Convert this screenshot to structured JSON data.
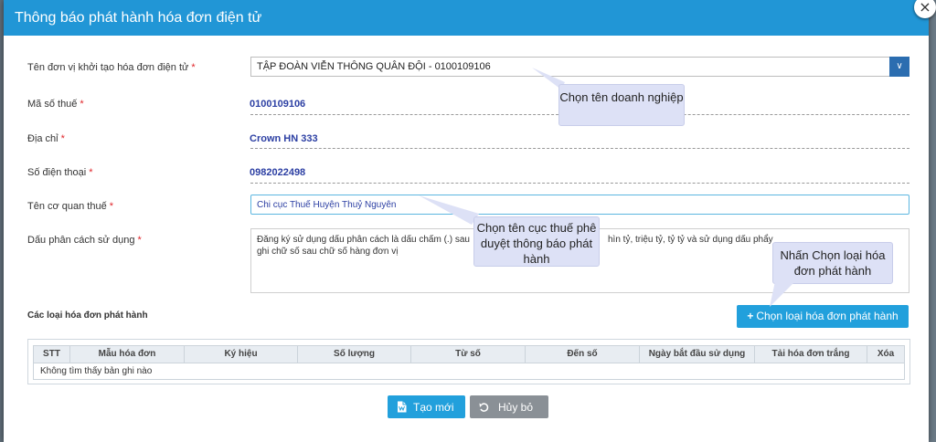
{
  "dialog": {
    "title": "Thông báo phát hành hóa đơn điện tử",
    "close_symbol": "×"
  },
  "form": {
    "org_label": "Tên đơn vị khởi tạo hóa đơn điện tử",
    "org_value": "TẬP ĐOÀN VIỄN THÔNG QUÂN ĐỘI - 0100109106",
    "tax_code_label": "Mã số thuế",
    "tax_code_value": "0100109106",
    "address_label": "Địa chỉ",
    "address_value": "Crown HN 333",
    "phone_label": "Số điện thoại",
    "phone_value": "0982022498",
    "tax_office_label": "Tên cơ quan thuế",
    "tax_office_value": "Chi cục Thuế Huyện Thuỷ Nguyên",
    "separator_label": "Dấu phân cách sử dụng",
    "separator_text_line1_a": "Đăng ký sử dụng dấu phân cách là dấu chấm (.) sau",
    "separator_text_line1_b": "hìn tỷ, triệu tỷ, tỷ tỷ và sử dụng dấu phẩy",
    "separator_text_line2": "ghi chữ số sau chữ số hàng đơn vị",
    "required_mark": "*"
  },
  "invoice_types": {
    "section_title": "Các loại hóa đơn phát hành",
    "add_button_label": "Chọn loại hóa đơn phát hành",
    "add_button_icon": "+",
    "columns": [
      "STT",
      "Mẫu hóa đơn",
      "Ký hiệu",
      "Số lượng",
      "Từ số",
      "Đến số",
      "Ngày bắt đầu sử dụng",
      "Tải hóa đơn trắng",
      "Xóa"
    ],
    "empty_message": "Không tìm thấy bản ghi nào"
  },
  "footer": {
    "create_label": "Tạo mới",
    "cancel_label": "Hủy bỏ"
  },
  "tooltips": {
    "company": "Chọn tên doanh nghiệp",
    "tax_office": "Chọn tên cục thuế phê duyệt thông báo phát hành",
    "invoice_type": "Nhấn Chọn loại hóa đơn phát hành"
  },
  "colors": {
    "header": "#2196d6",
    "primary_button": "#22a0dc",
    "cancel_button": "#8a9096",
    "value_text": "#2c3fa3",
    "required": "#e0262b",
    "tooltip_bg": "#dde1f6"
  }
}
